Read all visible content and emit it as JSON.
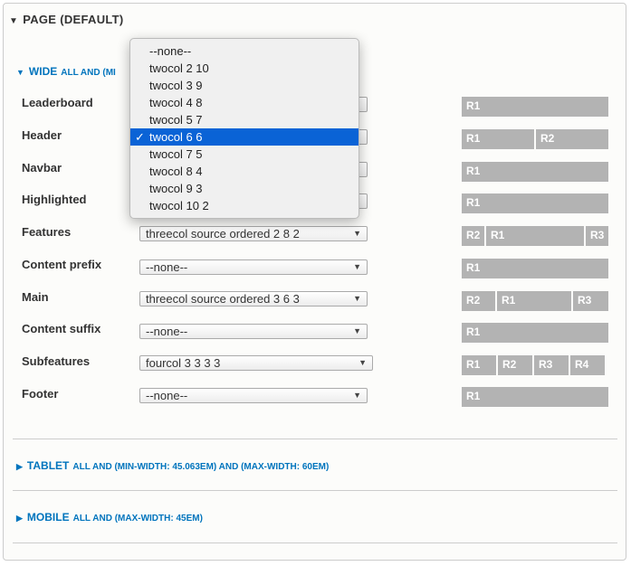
{
  "page_title": "PAGE (DEFAULT)",
  "wide": {
    "title": "WIDE",
    "sub": "ALL AND (MI"
  },
  "rows": [
    {
      "label": "Leaderboard",
      "select": "",
      "regions": [
        "R1"
      ]
    },
    {
      "label": "Header",
      "select": "",
      "regions": [
        "R1",
        "R2"
      ]
    },
    {
      "label": "Navbar",
      "select": "",
      "regions": [
        "R1"
      ]
    },
    {
      "label": "Highlighted",
      "select": "",
      "regions": [
        "R1"
      ]
    },
    {
      "label": "Features",
      "select": "threecol source ordered 2 8 2",
      "regions": [
        "R2",
        "R1",
        "R3"
      ]
    },
    {
      "label": "Content prefix",
      "select": "--none--",
      "regions": [
        "R1"
      ]
    },
    {
      "label": "Main",
      "select": "threecol source ordered 3 6 3",
      "regions": [
        "R2",
        "R1",
        "R3"
      ]
    },
    {
      "label": "Content suffix",
      "select": "--none--",
      "regions": [
        "R1"
      ]
    },
    {
      "label": "Subfeatures",
      "select": "fourcol 3 3 3 3",
      "regions": [
        "R1",
        "R2",
        "R3",
        "R4"
      ]
    },
    {
      "label": "Footer",
      "select": "--none--",
      "regions": [
        "R1"
      ]
    }
  ],
  "tablet": {
    "title": "TABLET",
    "sub": "ALL AND (MIN-WIDTH: 45.063EM) AND (MAX-WIDTH: 60EM)"
  },
  "mobile": {
    "title": "MOBILE",
    "sub": "ALL AND (MAX-WIDTH: 45EM)"
  },
  "dropdown": {
    "options": [
      "--none--",
      "twocol 2 10",
      "twocol 3 9",
      "twocol 4 8",
      "twocol 5 7",
      "twocol 6 6",
      "twocol 7 5",
      "twocol 8 4",
      "twocol 9 3",
      "twocol 10 2"
    ],
    "selected": "twocol 6 6",
    "check": "✓"
  },
  "icons": {
    "expanded": "triangle-down-icon",
    "collapsed": "triangle-right-icon",
    "select_arrow": "chevron-down-icon"
  },
  "colors": {
    "link": "#0074bd",
    "region": "#b3b3b3",
    "highlight": "#0a63d6"
  }
}
